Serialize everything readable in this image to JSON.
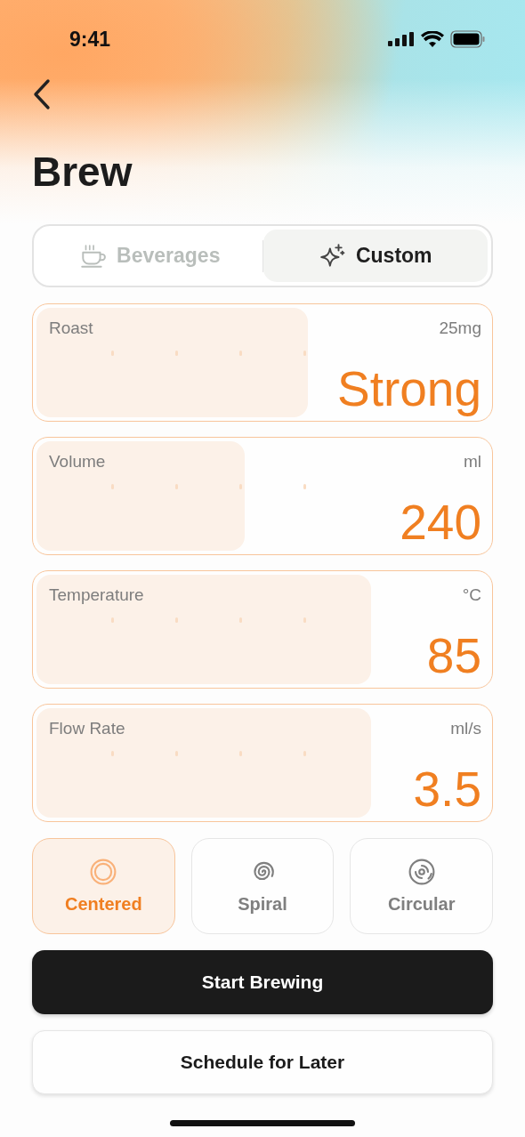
{
  "status_bar": {
    "time": "9:41"
  },
  "title": "Brew",
  "tabs": [
    {
      "label": "Beverages",
      "kind": "cup",
      "selected": false
    },
    {
      "label": "Custom",
      "kind": "sparkle",
      "selected": true
    }
  ],
  "settings": [
    {
      "label": "Roast",
      "unit": "25mg",
      "value": "Strong",
      "level": 0.6
    },
    {
      "label": "Volume",
      "unit": "ml",
      "value": "240",
      "level": 0.46
    },
    {
      "label": "Temperature",
      "unit": "°C",
      "value": "85",
      "level": 0.74
    },
    {
      "label": "Flow Rate",
      "unit": "ml/s",
      "value": "3.5",
      "level": 0.74
    }
  ],
  "patterns": [
    {
      "label": "Centered",
      "kind": "centered",
      "selected": true
    },
    {
      "label": "Spiral",
      "kind": "spiral",
      "selected": false
    },
    {
      "label": "Circular",
      "kind": "circular",
      "selected": false
    }
  ],
  "buttons": [
    {
      "label": "Start Brewing",
      "kind": "primary"
    },
    {
      "label": "Schedule for Later",
      "kind": "secondary"
    }
  ]
}
